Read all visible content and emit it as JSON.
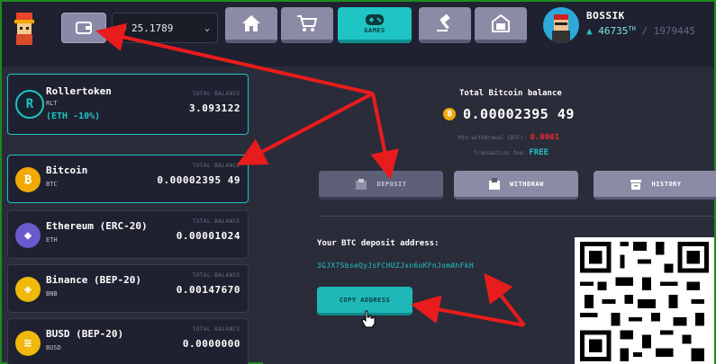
{
  "header": {
    "balance_value": "25.1789",
    "nav": [
      {
        "name": "home",
        "label": ""
      },
      {
        "name": "market",
        "label": ""
      },
      {
        "name": "games",
        "label": "GAMES"
      },
      {
        "name": "auction",
        "label": ""
      },
      {
        "name": "store",
        "label": ""
      }
    ],
    "user": {
      "name": "BOSSIK",
      "rank": "46735",
      "rank_suffix": "TH",
      "rank_total": "/ 1979445"
    }
  },
  "coins": [
    {
      "name": "Rollertoken",
      "ticker": "RLT",
      "extra": "(ETH -10%)",
      "balance_label": "TOTAL BALANCE",
      "amount": "3.093122",
      "color": "#16222e",
      "icon": "R"
    },
    {
      "name": "Bitcoin",
      "ticker": "BTC",
      "balance_label": "TOTAL BALANCE",
      "amount": "0.00002395 49",
      "color": "#f2a900",
      "icon": "₿"
    },
    {
      "name": "Ethereum (ERC-20)",
      "ticker": "ETH",
      "balance_label": "TOTAL BALANCE",
      "amount": "0.00001024",
      "color": "#6a5acd",
      "icon": "◆"
    },
    {
      "name": "Binance (BEP-20)",
      "ticker": "BNB",
      "balance_label": "TOTAL BALANCE",
      "amount": "0.00147670",
      "color": "#f0b90b",
      "icon": "◈"
    },
    {
      "name": "BUSD (BEP-20)",
      "ticker": "BUSD",
      "balance_label": "TOTAL BALANCE",
      "amount": "0.0000000",
      "color": "#f0b90b",
      "icon": "≋"
    }
  ],
  "wallet": {
    "title": "Total Bitcoin balance",
    "amount": "0.00002395 49",
    "min_withdrawal_label": "Min withdrawal (BTC):",
    "min_withdrawal_value": "0.0001",
    "tx_fee_label": "Transaction fee:",
    "tx_fee_value": "FREE",
    "deposit_label": "DEPOSIT",
    "withdraw_label": "WITHDRAW",
    "history_label": "HISTORY",
    "deposit_address_label": "Your BTC deposit address:",
    "deposit_address": "3GJX7SbseQyJsFCHUZJxn6oKFnJomAhFkH",
    "copy_label": "COPY ADDRESS"
  },
  "colors": {
    "accent": "#1fc4c4",
    "annotation_arrow": "#e81c1c",
    "btc": "#f2a900"
  }
}
